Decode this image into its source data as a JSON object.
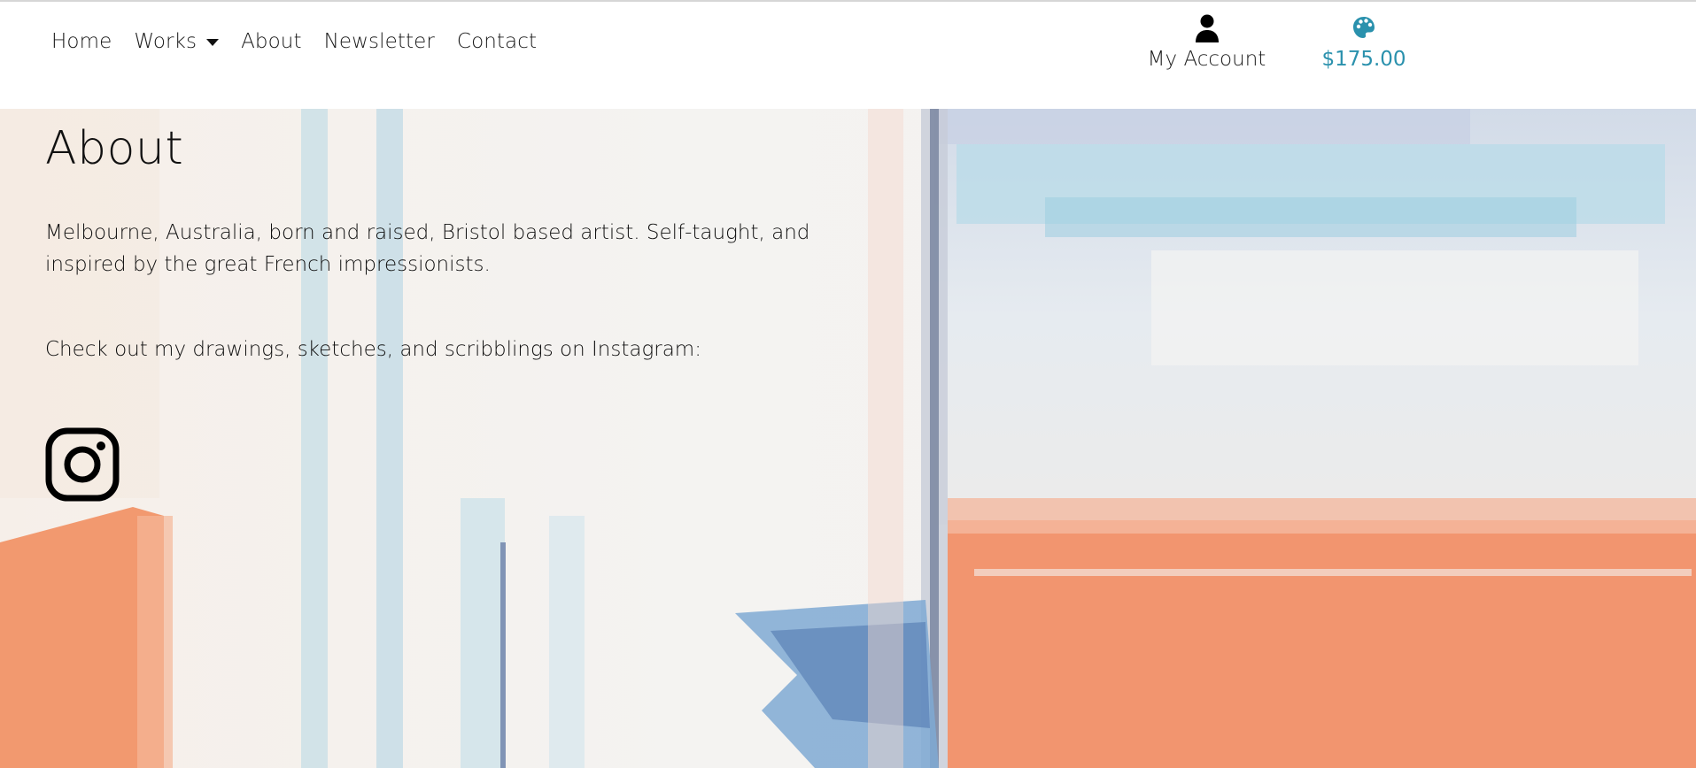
{
  "nav": {
    "items": [
      {
        "label": "Home"
      },
      {
        "label": "Works",
        "has_dropdown": true
      },
      {
        "label": "About"
      },
      {
        "label": "Newsletter"
      },
      {
        "label": "Contact"
      }
    ]
  },
  "account": {
    "label": "My Account",
    "icon": "user-icon"
  },
  "cart": {
    "total": "$175.00",
    "icon": "palette-icon",
    "color": "#2a91ad"
  },
  "page": {
    "title": "About",
    "paragraph_1": "Melbourne, Australia, born and raised, Bristol based artist. Self-taught, and inspired by the great French impressionists.",
    "paragraph_2": "Check out my drawings, sketches, and scribblings on Instagram:",
    "social_icon": "instagram-icon"
  }
}
